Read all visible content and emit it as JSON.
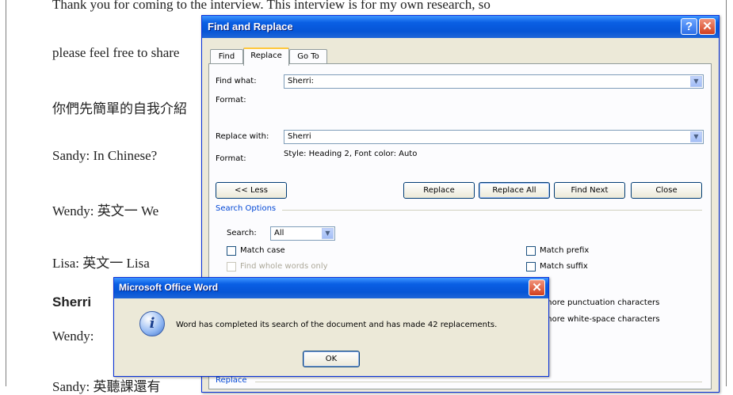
{
  "document": {
    "lines": [
      "Thank you for coming to the interview. This interview is for my own research, so",
      "please feel free to share",
      "你們先簡單的自我介紹",
      "Sandy: In Chinese?",
      "Wendy: 英文一  We",
      "Lisa: 英文一  Lisa",
      "Sherri",
      "Wendy:",
      "Sandy: 英聽課還有"
    ]
  },
  "find_replace": {
    "title": "Find and Replace",
    "help_glyph": "?",
    "close_glyph": "✕",
    "tabs": [
      "Find",
      "Replace",
      "Go To"
    ],
    "find_what_label": "Find what:",
    "find_what_value": "Sherri:",
    "format_label_1": "Format:",
    "format_value_1": "",
    "replace_with_label": "Replace with:",
    "replace_with_value": "Sherri",
    "format_label_2": "Format:",
    "format_value_2": "Style: Heading 2, Font color: Auto",
    "buttons": {
      "less": "<< Less",
      "replace": "Replace",
      "replace_all": "Replace All",
      "find_next": "Find Next",
      "close": "Close"
    },
    "search_options_label": "Search Options",
    "search_label": "Search:",
    "search_value": "All",
    "options_left": [
      "Match case",
      "Find whole words only"
    ],
    "options_right": [
      "Match prefix",
      "Match suffix",
      "Ignore punctuation characters",
      "Ignore white-space characters"
    ],
    "replace_section_label": "Replace"
  },
  "message_box": {
    "title": "Microsoft Office Word",
    "close_glyph": "✕",
    "icon_glyph": "i",
    "message": "Word has completed its search of the document and has made 42 replacements.",
    "ok_label": "OK"
  },
  "colors": {
    "titlebar": "#0655d6",
    "dialog_bg": "#ece9d8",
    "section_text": "#0046d5"
  }
}
